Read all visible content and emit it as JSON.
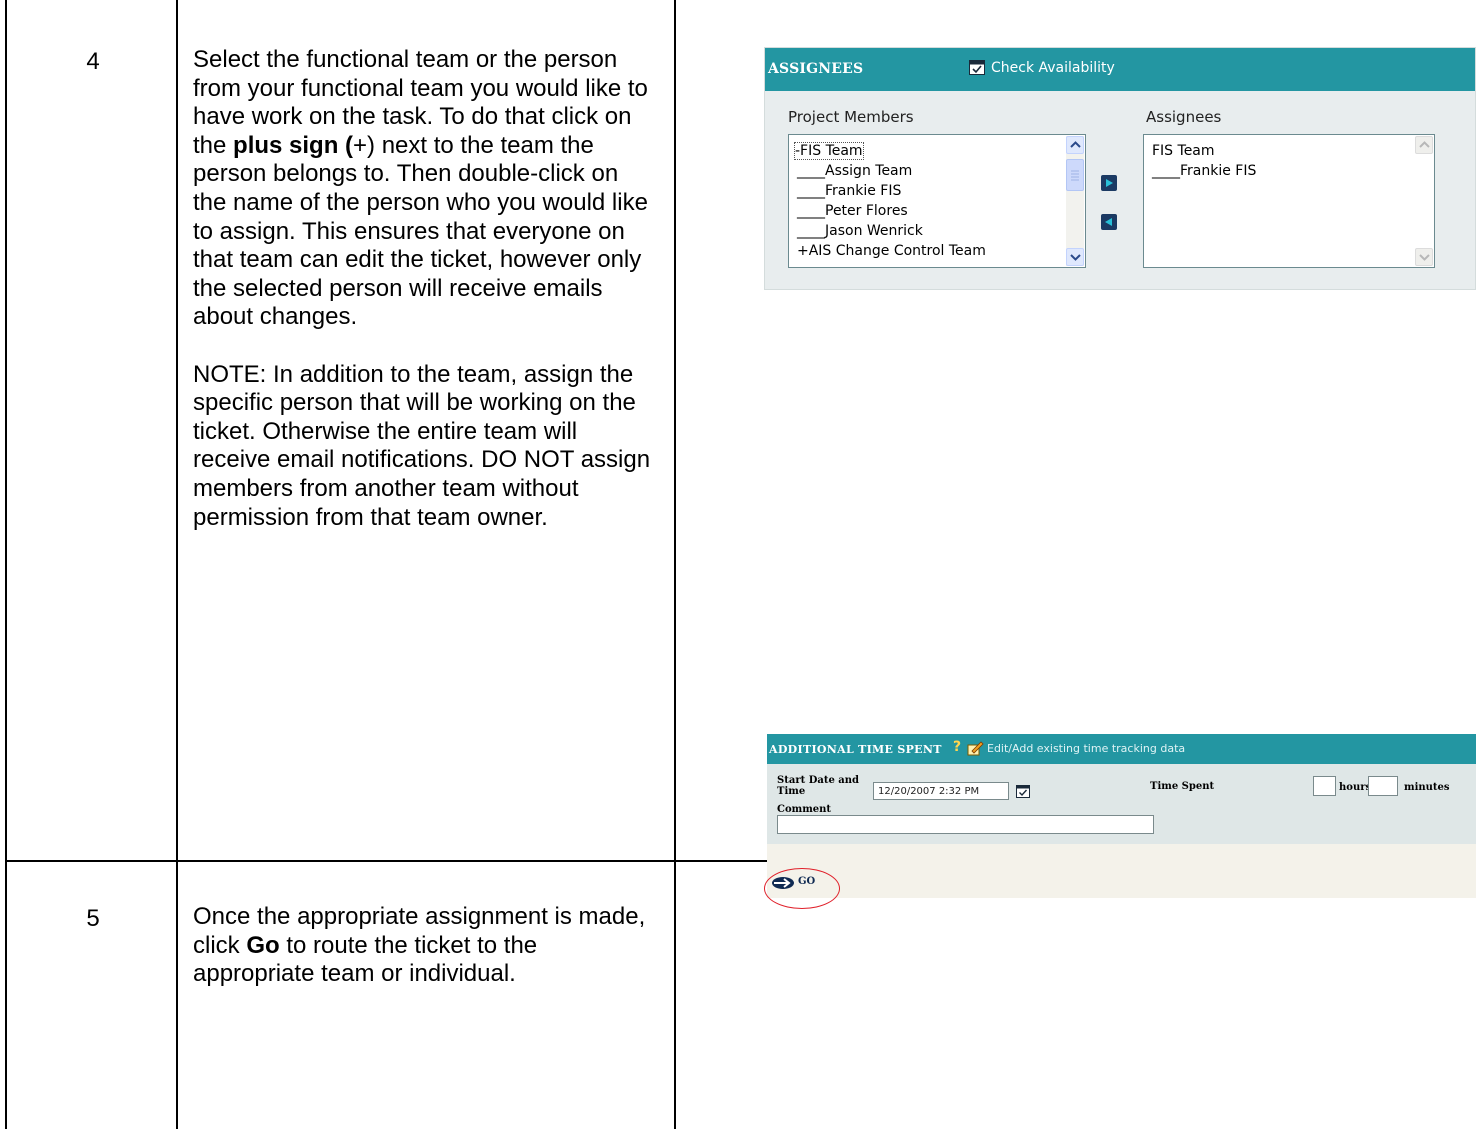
{
  "steps": [
    {
      "number": "4",
      "paragraph1_before": "Select the  functional team or the person from your functional team you would like to have work on the task.  To do that click on the ",
      "paragraph1_bold1": "plus sign (",
      "paragraph1_plus": "+",
      "paragraph1_after_plus": ") next to the team the person belongs to.  Then double-click on the name of the person who you would like to assign.  This ensures that everyone on that team can edit the ticket, however only the selected person will receive emails about changes.",
      "note": "NOTE:  In addition to the team, assign the specific person that will be working on the ticket.  Otherwise the entire team will receive email notifications.  DO NOT assign members from another team without permission from that team owner."
    },
    {
      "number": "5",
      "paragraph_before": "Once the appropriate assignment is made, click ",
      "paragraph_bold": "Go",
      "paragraph_after": " to route the ticket to the appropriate team or individual."
    }
  ],
  "assignees_widget": {
    "title": "ASSIGNEES",
    "check_availability": "Check Availability",
    "project_members_label": "Project Members",
    "assignees_label": "Assignees",
    "project_members": [
      "-FIS Team",
      "____Assign Team",
      "____Frankie FIS",
      "____Peter Flores",
      "____Jason Wenrick",
      "+AIS Change Control Team"
    ],
    "assignees": [
      "FIS Team",
      "____Frankie FIS"
    ]
  },
  "time_widget": {
    "title": "ADDITIONAL TIME SPENT",
    "help": "?",
    "edit_link": "Edit/Add existing time tracking data",
    "start_label_line1": "Start Date and",
    "start_label_line2": "Time",
    "start_value": "12/20/2007 2:32 PM",
    "time_spent_label": "Time Spent",
    "hours_label": "hours",
    "minutes_label": "minutes",
    "comment_label": "Comment",
    "go_label": "GO"
  },
  "colors": {
    "header_teal": "#2396a2",
    "highlight_red": "#e0202a"
  }
}
